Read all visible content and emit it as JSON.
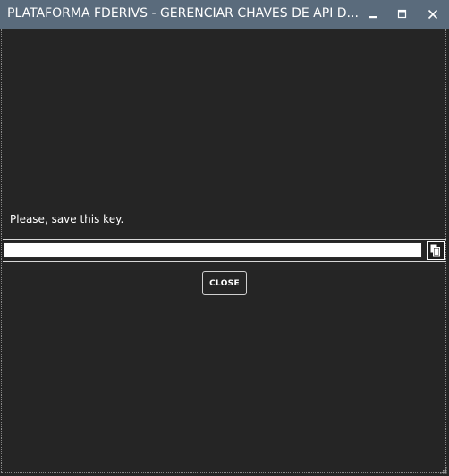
{
  "window": {
    "title": "PLATAFORMA FDERIVS - GERENCIAR CHAVES DE API D...",
    "titlebar_color": "#5a6b7c",
    "background_color": "#252525",
    "controls": {
      "minimize_icon": "minimize-icon",
      "maximize_icon": "maximize-icon",
      "close_icon": "close-icon"
    }
  },
  "dialog": {
    "message": "Please, save this key.",
    "key_field": {
      "value": "",
      "placeholder": ""
    },
    "copy_button_icon": "copy-icon",
    "close_button_label": "CLOSE"
  }
}
